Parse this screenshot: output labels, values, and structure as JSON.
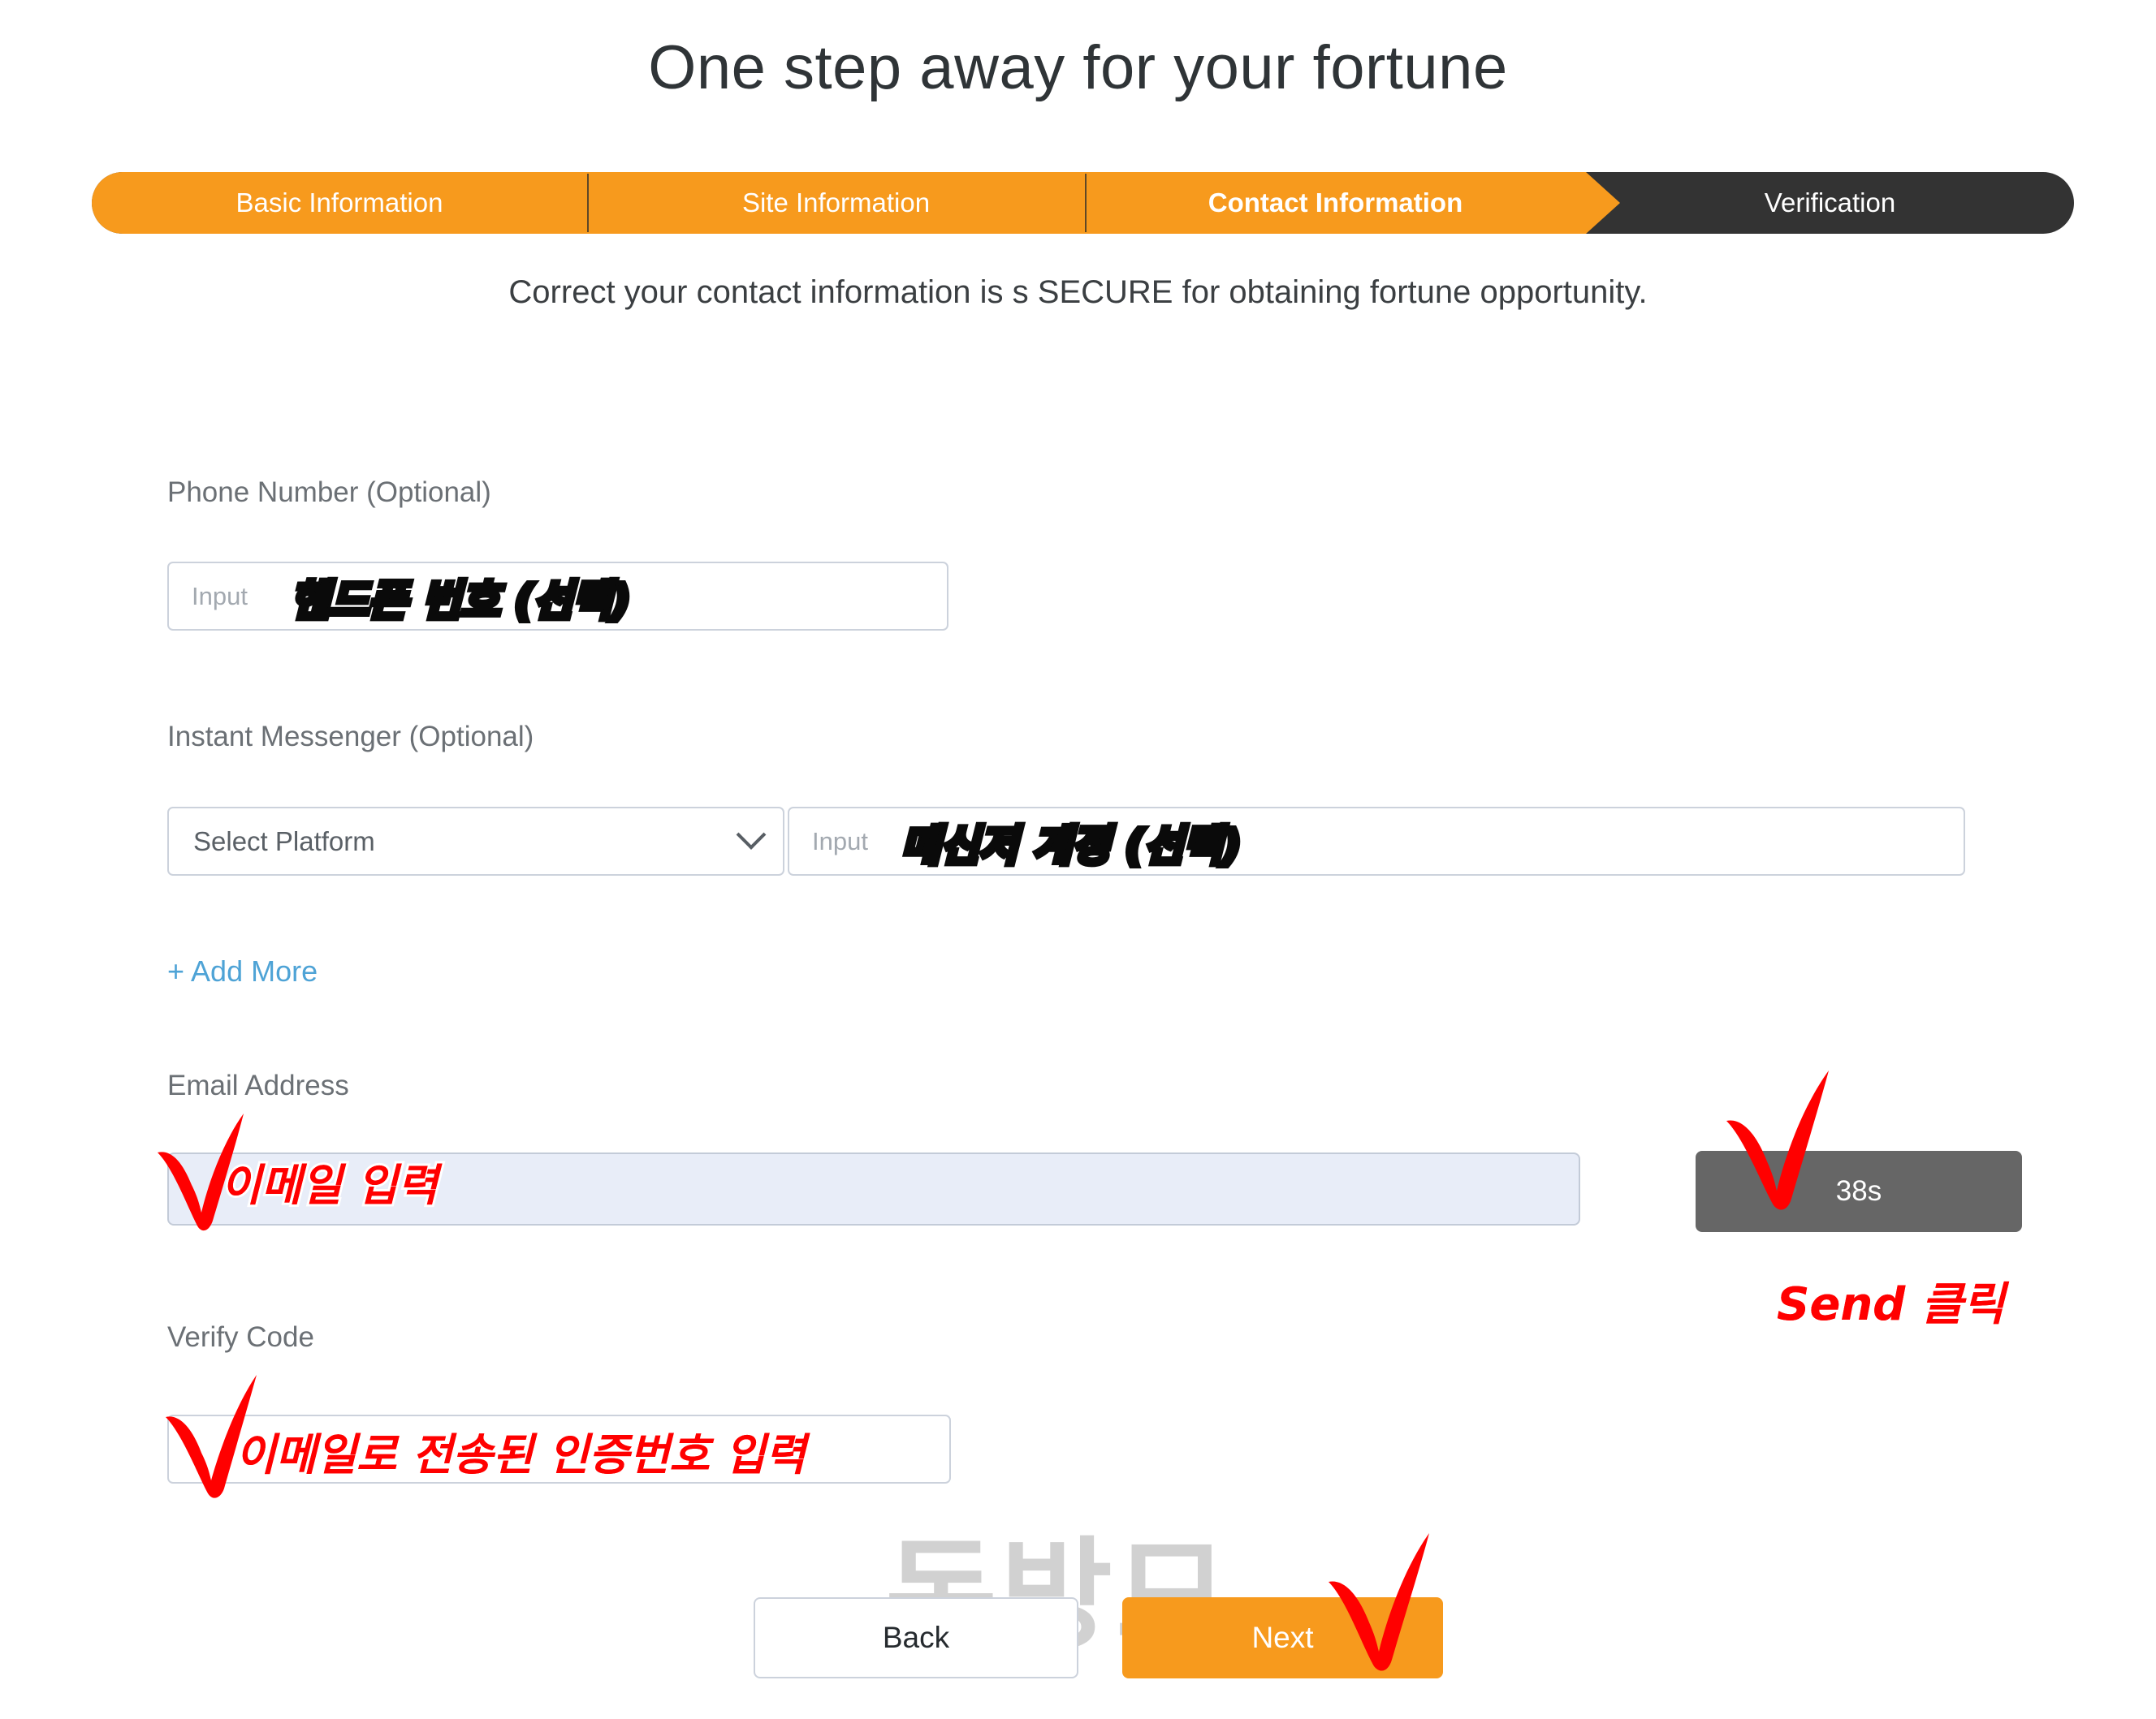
{
  "page": {
    "title": "One step away for your fortune",
    "subtitle": "Correct your contact information is s SECURE for obtaining fortune opportunity.",
    "watermark": "돈방모"
  },
  "colors": {
    "accent_orange": "#f79a1d",
    "step_dark": "#333333",
    "link_blue": "#4ea3d6",
    "annotation_red": "#ff0000",
    "send_gray": "#666666",
    "email_field_bg": "#e8edf8"
  },
  "steps": {
    "items": [
      {
        "label": "Basic Information",
        "state": "completed"
      },
      {
        "label": "Site Information",
        "state": "completed"
      },
      {
        "label": "Contact Information",
        "state": "current"
      },
      {
        "label": "Verification",
        "state": "upcoming"
      }
    ]
  },
  "form": {
    "phone": {
      "label": "Phone Number (Optional)",
      "placeholder": "Input",
      "value": ""
    },
    "messenger": {
      "label": "Instant Messenger (Optional)",
      "platform_selected": "Select Platform",
      "account_placeholder": "Input",
      "account_value": "",
      "add_more_label": "+ Add More"
    },
    "email": {
      "label": "Email Address",
      "value": "",
      "send_button_label": "38s"
    },
    "verify": {
      "label": "Verify Code",
      "placeholder": "",
      "value": ""
    }
  },
  "actions": {
    "back_label": "Back",
    "next_label": "Next"
  },
  "annotations": [
    {
      "text": "핸드폰 번호 (선택)",
      "style": "black",
      "target": "phone-input"
    },
    {
      "text": "메신저 계정 (선택)",
      "style": "black",
      "target": "messenger-account-input"
    },
    {
      "text": "이메일 입력",
      "style": "red",
      "target": "email-input"
    },
    {
      "text": "Send 클릭",
      "style": "red",
      "target": "send-button"
    },
    {
      "text": "이메일로 전송된 인증번호 입력",
      "style": "red",
      "target": "verify-code-input"
    }
  ]
}
